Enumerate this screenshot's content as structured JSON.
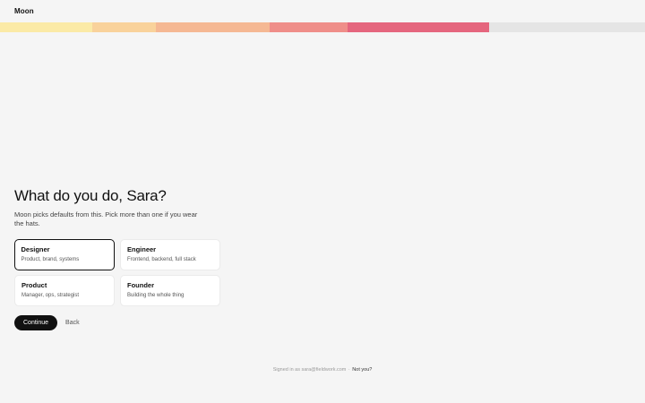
{
  "app": {
    "brand": "Moon"
  },
  "progress": {
    "segments": [
      {
        "color": "#fbeaa6",
        "share": 0.143
      },
      {
        "color": "#f9d29b",
        "share": 0.099
      },
      {
        "color": "#f5b893",
        "share": 0.176
      },
      {
        "color": "#ef8e89",
        "share": 0.121
      },
      {
        "color": "#e5667e",
        "share": 0.219
      }
    ],
    "track_color": "#e5e5e5"
  },
  "main": {
    "title": "What do you do, Sara?",
    "subtitle": "Moon picks defaults from this. Pick more than one if you wear the hats.",
    "options": [
      {
        "title": "Designer",
        "description": "Product, brand, systems",
        "selected": true
      },
      {
        "title": "Engineer",
        "description": "Frontend, backend, full stack",
        "selected": false
      },
      {
        "title": "Product",
        "description": "Manager, ops, strategist",
        "selected": false
      },
      {
        "title": "Founder",
        "description": "Building the whole thing",
        "selected": false
      }
    ],
    "continue_label": "Continue",
    "back_label": "Back"
  },
  "footer": {
    "signed_in_text": "Signed in as sara@fieldwork.com",
    "separator": "·",
    "not_you_label": "Not you?"
  }
}
